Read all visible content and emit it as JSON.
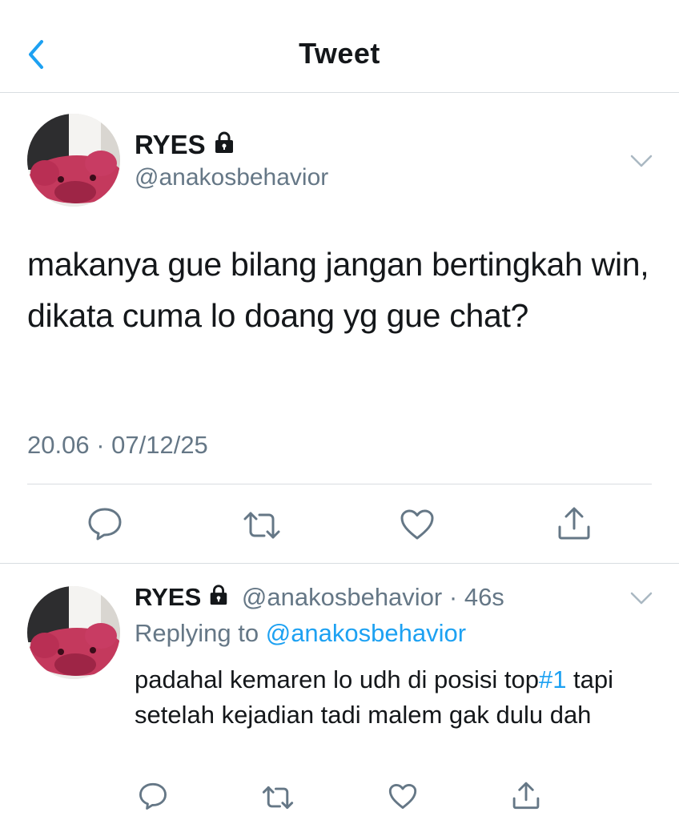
{
  "header": {
    "title": "Tweet",
    "back_icon": "chevron-left-icon"
  },
  "colors": {
    "accent": "#1da1f2",
    "text": "#14171a",
    "secondary": "#657786",
    "divider": "#d8dde1"
  },
  "main_tweet": {
    "display_name": "RYES",
    "handle": "@anakosbehavior",
    "protected_icon": "lock-icon",
    "text": "makanya gue bilang jangan bertingkah win, dikata cuma lo doang yg gue chat?",
    "date_time": "20.06 · 07/12/25",
    "actions": [
      "reply-icon",
      "retweet-icon",
      "like-icon",
      "share-icon"
    ]
  },
  "reply_tweet": {
    "display_name": "RYES",
    "handle": "@anakosbehavior",
    "separator": " · ",
    "time": "46s",
    "replying_label": "Replying to",
    "replying_to": "@anakosbehavior",
    "text_before_tag": "padahal kemaren lo udh di posisi top",
    "hashtag": "#1",
    "text_after_tag": " tapi setelah kejadian tadi malem gak dulu dah",
    "actions": [
      "reply-icon",
      "retweet-icon",
      "like-icon",
      "share-icon"
    ]
  }
}
